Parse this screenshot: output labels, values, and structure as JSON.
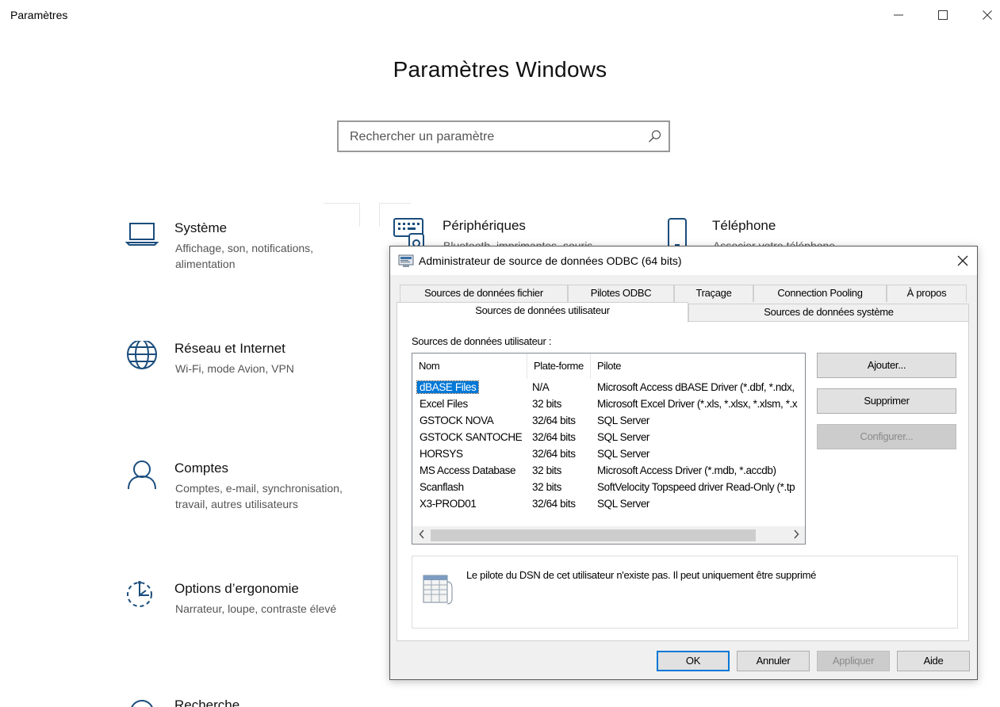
{
  "window": {
    "title": "Paramètres",
    "heading": "Paramètres Windows"
  },
  "search": {
    "placeholder": "Rechercher un paramètre",
    "icon": "search-icon"
  },
  "categories": [
    {
      "title": "Système",
      "desc": "Affichage, son, notifications, alimentation",
      "icon": "laptop-icon"
    },
    {
      "title": "Périphériques",
      "desc": "Bluetooth, imprimantes, souris",
      "icon": "keyboard-icon"
    },
    {
      "title": "Téléphone",
      "desc": "Associer votre téléphone",
      "icon": "phone-icon"
    },
    {
      "title": "Réseau et Internet",
      "desc": "Wi-Fi, mode Avion, VPN",
      "icon": "globe-icon"
    },
    {
      "title": "Comptes",
      "desc": "Comptes, e-mail, synchronisation, travail, autres utilisateurs",
      "icon": "person-icon"
    },
    {
      "title": "Options d’ergonomie",
      "desc": "Narrateur, loupe, contraste élevé",
      "icon": "ease-of-access-icon"
    },
    {
      "title": "Recherche",
      "desc": ""
    }
  ],
  "dialog": {
    "title": "Administrateur de source de données ODBC (64 bits)",
    "tabs_back": [
      "Sources de données fichier",
      "Pilotes ODBC",
      "Traçage",
      "Connection Pooling",
      "À propos"
    ],
    "tabs_front": [
      "Sources de données utilisateur",
      "Sources de données système"
    ],
    "list_label": "Sources de données utilisateur :",
    "columns": [
      "Nom",
      "Plate-forme",
      "Pilote"
    ],
    "rows": [
      {
        "name": "dBASE Files",
        "platform": "N/A",
        "driver": "Microsoft Access dBASE Driver (*.dbf, *.ndx,"
      },
      {
        "name": "Excel Files",
        "platform": "32 bits",
        "driver": "Microsoft Excel Driver (*.xls, *.xlsx, *.xlsm, *.x"
      },
      {
        "name": "GSTOCK NOVA",
        "platform": "32/64 bits",
        "driver": "SQL Server"
      },
      {
        "name": "GSTOCK SANTOCHE",
        "platform": "32/64 bits",
        "driver": "SQL Server"
      },
      {
        "name": "HORSYS",
        "platform": "32/64 bits",
        "driver": "SQL Server"
      },
      {
        "name": "MS Access Database",
        "platform": "32 bits",
        "driver": "Microsoft Access Driver (*.mdb, *.accdb)"
      },
      {
        "name": "Scanflash",
        "platform": "32 bits",
        "driver": "SoftVelocity Topspeed driver Read-Only (*.tp"
      },
      {
        "name": "X3-PROD01",
        "platform": "32/64 bits",
        "driver": "SQL Server"
      }
    ],
    "buttons_side": {
      "add": "Ajouter...",
      "remove": "Supprimer",
      "configure": "Configurer..."
    },
    "info_text": "Le pilote du DSN de cet utilisateur n'existe pas. Il peut uniquement être supprimé",
    "buttons_bottom": {
      "ok": "OK",
      "cancel": "Annuler",
      "apply": "Appliquer",
      "help": "Aide"
    }
  },
  "colors": {
    "accent": "#0078d7",
    "icon": "#1a4d7c"
  }
}
